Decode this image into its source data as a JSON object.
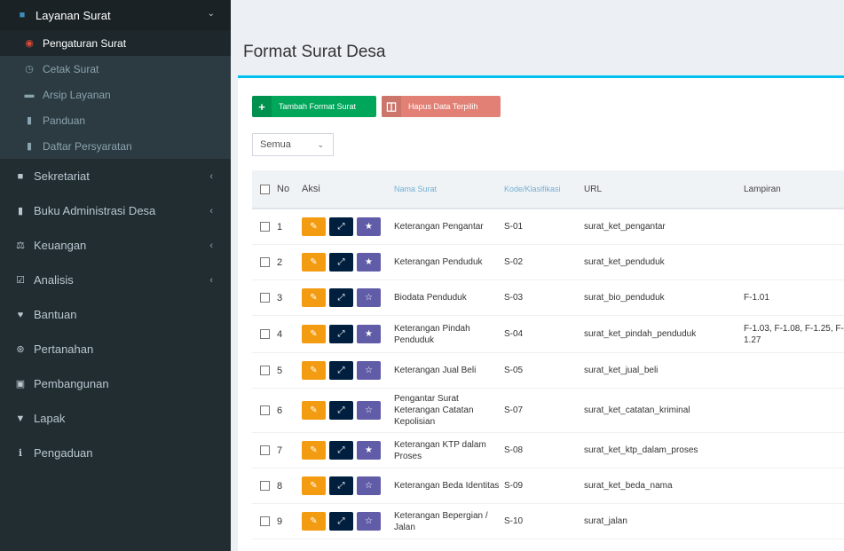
{
  "sidebar": {
    "header": "Layanan Surat",
    "sub_items": [
      {
        "label": "Pengaturan Surat",
        "active": true
      },
      {
        "label": "Cetak Surat",
        "active": false
      },
      {
        "label": "Arsip Layanan",
        "active": false
      },
      {
        "label": "Panduan",
        "active": false
      },
      {
        "label": "Daftar Persyaratan",
        "active": false
      }
    ],
    "items": [
      {
        "label": "Sekretariat",
        "has_arrow": true
      },
      {
        "label": "Buku Administrasi Desa",
        "has_arrow": true
      },
      {
        "label": "Keuangan",
        "has_arrow": true
      },
      {
        "label": "Analisis",
        "has_arrow": true
      },
      {
        "label": "Bantuan",
        "has_arrow": false
      },
      {
        "label": "Pertanahan",
        "has_arrow": false
      },
      {
        "label": "Pembangunan",
        "has_arrow": false
      },
      {
        "label": "Lapak",
        "has_arrow": false
      },
      {
        "label": "Pengaduan",
        "has_arrow": false
      }
    ]
  },
  "main": {
    "title": "Format Surat Desa",
    "buttons": {
      "add": "Tambah Format Surat",
      "delete": "Hapus Data Terpilih"
    },
    "filter": {
      "value": "Semua"
    },
    "table": {
      "headers": [
        "No",
        "Aksi",
        "Nama Surat",
        "Kode/Klasifikasi",
        "URL",
        "Lampiran"
      ],
      "rows": [
        {
          "no": "1",
          "nama": "Keterangan Pengantar",
          "kode": "S-01",
          "url": "surat_ket_pengantar",
          "lampiran": "",
          "fav": true
        },
        {
          "no": "2",
          "nama": "Keterangan Penduduk",
          "kode": "S-02",
          "url": "surat_ket_penduduk",
          "lampiran": "",
          "fav": true
        },
        {
          "no": "3",
          "nama": "Biodata Penduduk",
          "kode": "S-03",
          "url": "surat_bio_penduduk",
          "lampiran": "F-1.01",
          "fav": false
        },
        {
          "no": "4",
          "nama": "Keterangan Pindah Penduduk",
          "kode": "S-04",
          "url": "surat_ket_pindah_penduduk",
          "lampiran": "F-1.03, F-1.08, F-1.25, F-1.27",
          "fav": true
        },
        {
          "no": "5",
          "nama": "Keterangan Jual Beli",
          "kode": "S-05",
          "url": "surat_ket_jual_beli",
          "lampiran": "",
          "fav": false
        },
        {
          "no": "6",
          "nama": "Pengantar Surat Keterangan Catatan Kepolisian",
          "kode": "S-07",
          "url": "surat_ket_catatan_kriminal",
          "lampiran": "",
          "fav": false
        },
        {
          "no": "7",
          "nama": "Keterangan KTP dalam Proses",
          "kode": "S-08",
          "url": "surat_ket_ktp_dalam_proses",
          "lampiran": "",
          "fav": true
        },
        {
          "no": "8",
          "nama": "Keterangan Beda Identitas",
          "kode": "S-09",
          "url": "surat_ket_beda_nama",
          "lampiran": "",
          "fav": false
        },
        {
          "no": "9",
          "nama": "Keterangan Bepergian / Jalan",
          "kode": "S-10",
          "url": "surat_jalan",
          "lampiran": "",
          "fav": false
        }
      ]
    }
  }
}
